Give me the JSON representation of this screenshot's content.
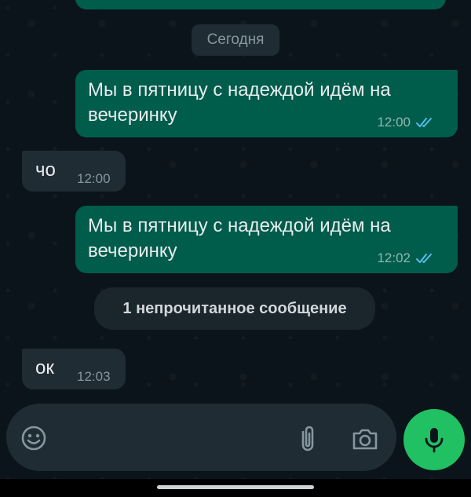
{
  "chat": {
    "date_chip": "Сегодня",
    "unread_banner": "1 непрочитанное сообщение",
    "messages": [
      {
        "direction": "outgoing",
        "text_line1": "Мы в пятницу с надеждой идём на",
        "text_line2": "вечеринку",
        "time": "12:00",
        "status": "read"
      },
      {
        "direction": "incoming",
        "text": "чо",
        "time": "12:00"
      },
      {
        "direction": "outgoing",
        "text_line1": "Мы в пятницу с надеждой идём на",
        "text_line2": "вечеринку",
        "time": "12:02",
        "status": "read"
      },
      {
        "direction": "incoming",
        "text": "ок",
        "time": "12:03"
      }
    ]
  },
  "composer": {
    "emoji_icon": "emoji-icon",
    "attach_icon": "paperclip-icon",
    "camera_icon": "camera-icon",
    "mic_icon": "microphone-icon"
  },
  "colors": {
    "background": "#0b141a",
    "outgoing_bubble": "#005c4b",
    "incoming_bubble": "#1f2c34",
    "read_ticks": "#53bdeb",
    "mic_button": "#21c063"
  }
}
